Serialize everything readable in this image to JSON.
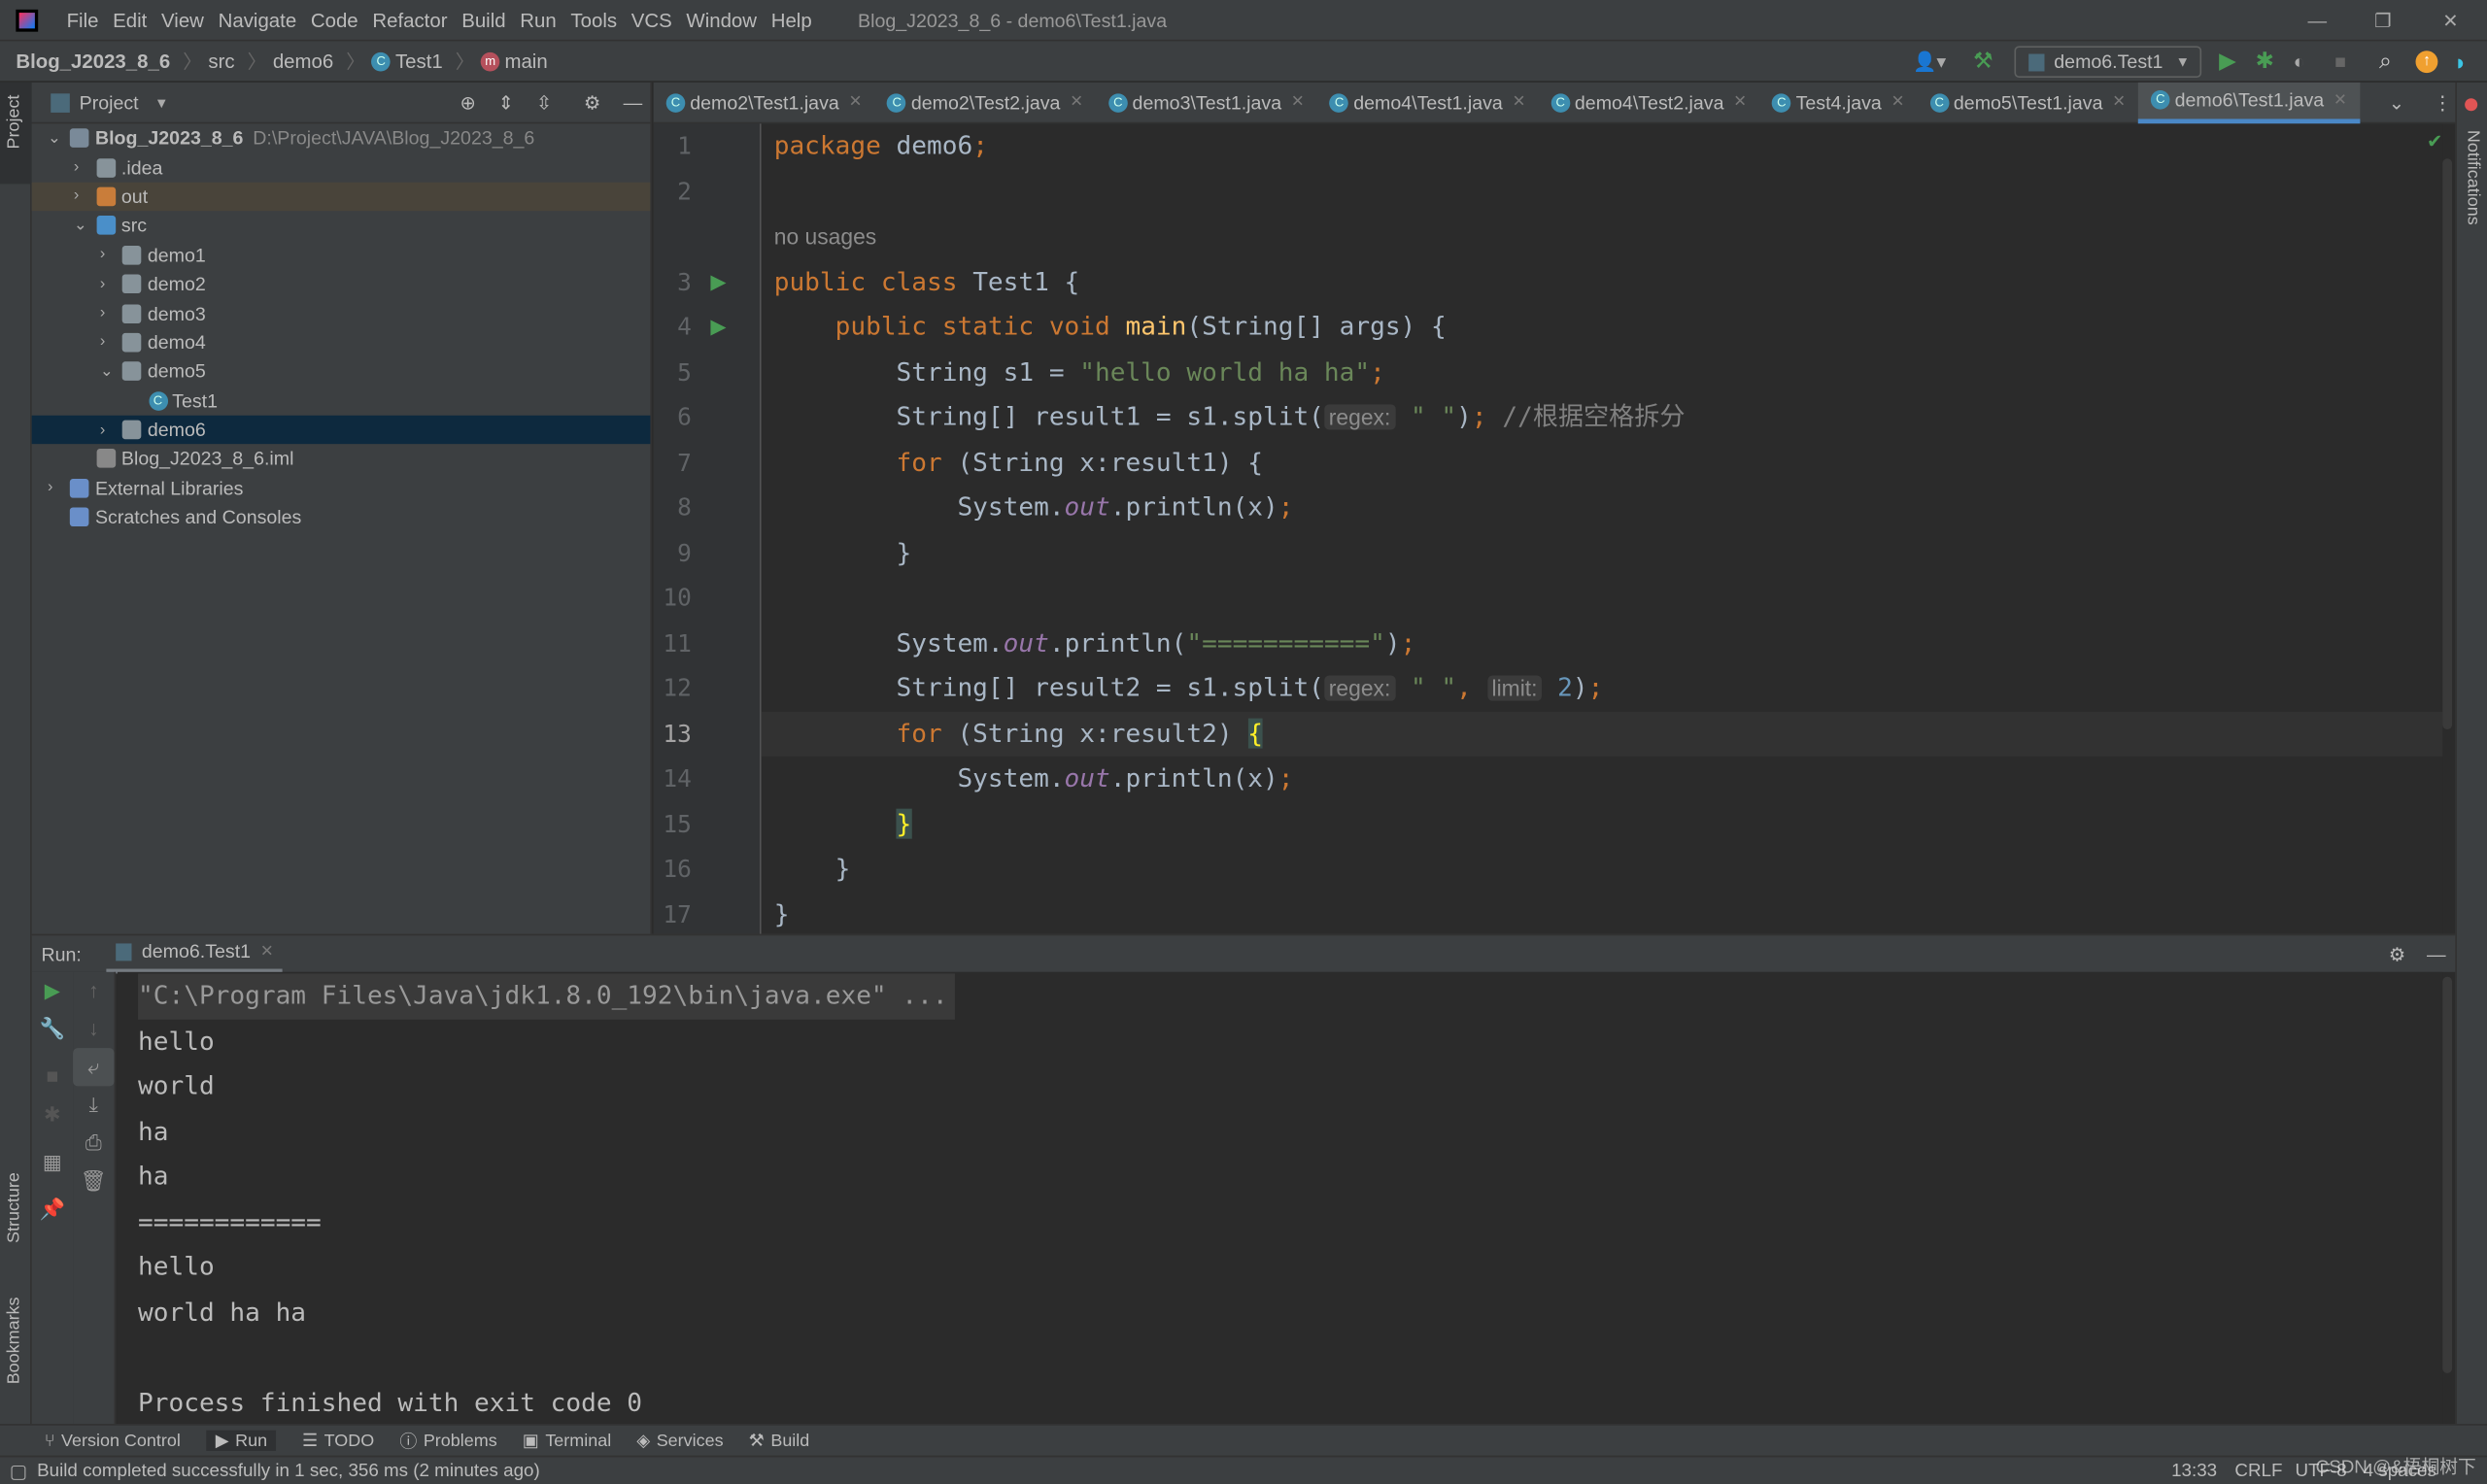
{
  "window": {
    "title": "Blog_J2023_8_6 - demo6\\Test1.java",
    "menu": [
      "File",
      "Edit",
      "View",
      "Navigate",
      "Code",
      "Refactor",
      "Build",
      "Run",
      "Tools",
      "VCS",
      "Window",
      "Help"
    ]
  },
  "breadcrumb": [
    "Blog_J2023_8_6",
    "src",
    "demo6",
    "Test1",
    "main"
  ],
  "run_config": "demo6.Test1",
  "side_tabs": {
    "left_top": "Project",
    "left_structure": "Structure",
    "left_bookmarks": "Bookmarks",
    "right": "Notifications"
  },
  "project": {
    "header": "Project",
    "tree": [
      {
        "label": "Blog_J2023_8_6",
        "path": "D:\\Project\\JAVA\\Blog_J2023_8_6",
        "depth": 0,
        "open": true,
        "type": "module"
      },
      {
        "label": ".idea",
        "depth": 1,
        "open": false,
        "type": "folder"
      },
      {
        "label": "out",
        "depth": 1,
        "open": false,
        "type": "folder-out"
      },
      {
        "label": "src",
        "depth": 1,
        "open": true,
        "type": "folder-src"
      },
      {
        "label": "demo1",
        "depth": 2,
        "open": false,
        "type": "package"
      },
      {
        "label": "demo2",
        "depth": 2,
        "open": false,
        "type": "package"
      },
      {
        "label": "demo3",
        "depth": 2,
        "open": false,
        "type": "package"
      },
      {
        "label": "demo4",
        "depth": 2,
        "open": false,
        "type": "package"
      },
      {
        "label": "demo5",
        "depth": 2,
        "open": true,
        "type": "package"
      },
      {
        "label": "Test1",
        "depth": 3,
        "type": "class"
      },
      {
        "label": "demo6",
        "depth": 2,
        "open": false,
        "type": "package",
        "selected": true
      },
      {
        "label": "Blog_J2023_8_6.iml",
        "depth": 1,
        "type": "file"
      },
      {
        "label": "External Libraries",
        "depth": 0,
        "open": false,
        "type": "lib"
      },
      {
        "label": "Scratches and Consoles",
        "depth": 0,
        "type": "scratch"
      }
    ]
  },
  "tabs": [
    {
      "label": "demo2\\Test1.java"
    },
    {
      "label": "demo2\\Test2.java"
    },
    {
      "label": "demo3\\Test1.java"
    },
    {
      "label": "demo4\\Test1.java"
    },
    {
      "label": "demo4\\Test2.java"
    },
    {
      "label": "Test4.java"
    },
    {
      "label": "demo5\\Test1.java"
    },
    {
      "label": "demo6\\Test1.java",
      "active": true
    }
  ],
  "editor": {
    "no_usages": "no usages",
    "current_line": 13,
    "lines": [
      {
        "n": "1",
        "t": [
          [
            "package ",
            "kw"
          ],
          [
            "demo6",
            "id"
          ],
          [
            ";",
            "kw"
          ]
        ]
      },
      {
        "n": "2",
        "t": []
      },
      {
        "n": "",
        "usage": true
      },
      {
        "n": "3",
        "run": true,
        "t": [
          [
            "public class ",
            "kw"
          ],
          [
            "Test1 {",
            "id"
          ]
        ]
      },
      {
        "n": "4",
        "run": true,
        "t": [
          [
            "    public static void ",
            "kw"
          ],
          [
            "main",
            "fn"
          ],
          [
            "(String[] args) {",
            "id"
          ]
        ]
      },
      {
        "n": "5",
        "t": [
          [
            "        String s1 = ",
            "id"
          ],
          [
            "\"hello world ha ha\"",
            "str"
          ],
          [
            ";",
            "kw"
          ]
        ]
      },
      {
        "n": "6",
        "t": [
          [
            "        String[] result1 = s1.split(",
            "id"
          ],
          [
            "regex:",
            "hint"
          ],
          [
            " \" \"",
            "str"
          ],
          [
            ")",
            "id"
          ],
          [
            ";",
            "kw"
          ],
          [
            " //根据空格拆分",
            "cm"
          ]
        ]
      },
      {
        "n": "7",
        "t": [
          [
            "        for ",
            "kw"
          ],
          [
            "(String x:result1) {",
            "id"
          ]
        ]
      },
      {
        "n": "8",
        "t": [
          [
            "            System.",
            "id"
          ],
          [
            "out",
            "fld"
          ],
          [
            ".println(x)",
            "id"
          ],
          [
            ";",
            "kw"
          ]
        ]
      },
      {
        "n": "9",
        "t": [
          [
            "        }",
            "id"
          ]
        ]
      },
      {
        "n": "10",
        "t": []
      },
      {
        "n": "11",
        "t": [
          [
            "        System.",
            "id"
          ],
          [
            "out",
            "fld"
          ],
          [
            ".println(",
            "id"
          ],
          [
            "\"===========\"",
            "str"
          ],
          [
            ")",
            "id"
          ],
          [
            ";",
            "kw"
          ]
        ]
      },
      {
        "n": "12",
        "t": [
          [
            "        String[] result2 = s1.split(",
            "id"
          ],
          [
            "regex:",
            "hint"
          ],
          [
            " \" \"",
            "str"
          ],
          [
            ", ",
            "kw"
          ],
          [
            "limit:",
            "hint"
          ],
          [
            " 2",
            "num"
          ],
          [
            ")",
            "id"
          ],
          [
            ";",
            "kw"
          ]
        ]
      },
      {
        "n": "13",
        "cur": true,
        "t": [
          [
            "        for ",
            "kw"
          ],
          [
            "(String x:result2) ",
            "id"
          ],
          [
            "{",
            "brace"
          ]
        ]
      },
      {
        "n": "14",
        "t": [
          [
            "            System.",
            "id"
          ],
          [
            "out",
            "fld"
          ],
          [
            ".println(x)",
            "id"
          ],
          [
            ";",
            "kw"
          ]
        ]
      },
      {
        "n": "15",
        "t": [
          [
            "        ",
            "id"
          ],
          [
            "}",
            "brace"
          ]
        ]
      },
      {
        "n": "16",
        "t": [
          [
            "    }",
            "id"
          ]
        ]
      },
      {
        "n": "17",
        "t": [
          [
            "}",
            "id"
          ]
        ]
      }
    ]
  },
  "run": {
    "label": "Run:",
    "tab": "demo6.Test1",
    "output": [
      "\"C:\\Program Files\\Java\\jdk1.8.0_192\\bin\\java.exe\" ...",
      "hello",
      "world",
      "ha",
      "ha",
      "============",
      "hello",
      "world ha ha",
      "",
      "Process finished with exit code 0"
    ]
  },
  "tool_windows": [
    "Version Control",
    "Run",
    "TODO",
    "Problems",
    "Terminal",
    "Services",
    "Build"
  ],
  "status": {
    "message": "Build completed successfully in 1 sec, 356 ms (2 minutes ago)",
    "position": "13:33",
    "line_sep": "CRLF",
    "encoding": "UTF-8",
    "indent": "4 spaces",
    "watermark": "CSDN @&梧桐树下"
  },
  "colors": {
    "keyword": "#cc7832",
    "string": "#6a8759",
    "accent": "#4a88c7",
    "run_green": "#499c54"
  }
}
